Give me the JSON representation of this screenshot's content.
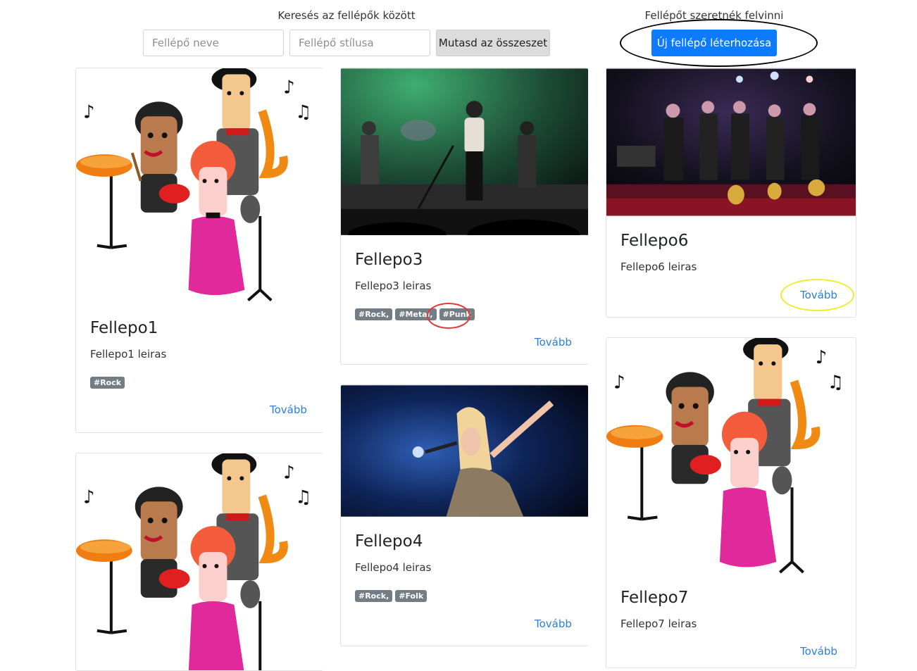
{
  "search": {
    "label": "Keresés az fellépők között",
    "name_placeholder": "Fellépő neve",
    "style_placeholder": "Fellépő stílusa",
    "show_all_label": "Mutasd az összeszet"
  },
  "create": {
    "label": "Fellépőt szeretnék felvinni",
    "button_label": "Új fellépő léterhozása"
  },
  "colors": {
    "primary": "#0d7bff",
    "link": "#2b7fd8",
    "tag": "#737d86",
    "annotation_black": "#000000",
    "annotation_red": "#e53935",
    "annotation_yellow": "#f3ea2a"
  },
  "cards": [
    {
      "title": "Fellepo1",
      "description": "Fellepo1 leiras",
      "tags": [
        "#Rock"
      ],
      "more": "Tovább",
      "image": "cartoon-band"
    },
    {
      "title": "Fellepo3",
      "description": "Fellepo3 leiras",
      "tags": [
        "#Rock,",
        "#Metal,",
        "#Punk"
      ],
      "more": "Tovább",
      "image": "concert-stage-green"
    },
    {
      "title": "Fellepo4",
      "description": "Fellepo4 leiras",
      "tags": [
        "#Rock,",
        "#Folk"
      ],
      "more": "Tovább",
      "image": "singer-microphone"
    },
    {
      "title": "Fellepo6",
      "description": "Fellepo6 leiras",
      "tags": [],
      "more": "Tovább",
      "image": "brass-band-stage"
    },
    {
      "title": "Fellepo7",
      "description": "Fellepo7 leiras",
      "tags": [],
      "more": "Tovább",
      "image": "cartoon-band"
    },
    {
      "image": "cartoon-band"
    }
  ]
}
